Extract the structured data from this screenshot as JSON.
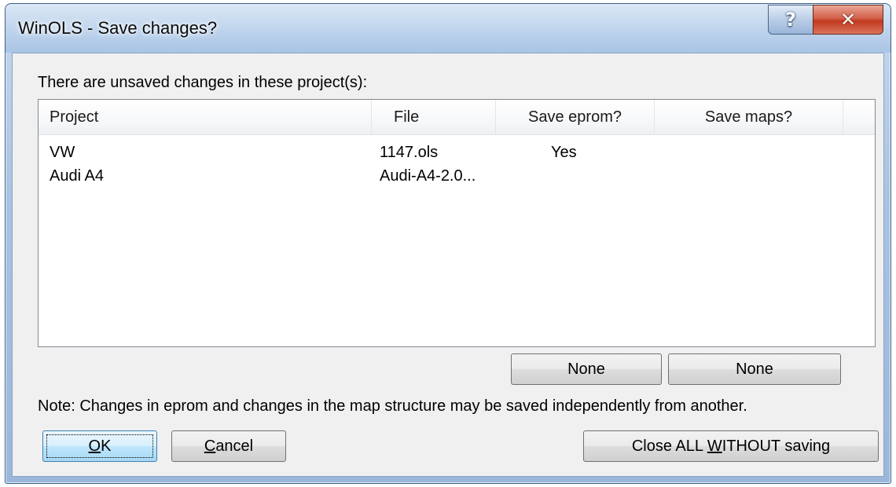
{
  "window": {
    "title": "WinOLS - Save changes?",
    "help_glyph": "?",
    "close_glyph": "✕"
  },
  "intro_text": "There are unsaved changes in these project(s):",
  "table": {
    "columns": [
      "Project",
      "File",
      "Save eprom?",
      "Save maps?"
    ],
    "rows": [
      {
        "project": "VW",
        "file": "1147.ols",
        "save_eprom": "Yes",
        "save_maps": ""
      },
      {
        "project": "Audi A4",
        "file": "Audi-A4-2.0...",
        "save_eprom": "",
        "save_maps": ""
      }
    ]
  },
  "buttons": {
    "eprom_none": "None",
    "maps_none": "None",
    "ok": {
      "accel": "O",
      "rest": "K"
    },
    "cancel": {
      "accel": "C",
      "rest": "ancel"
    },
    "close_all": {
      "before": "Close ALL ",
      "accel": "W",
      "after": "ITHOUT saving"
    }
  },
  "note_text": "Note: Changes in eprom and changes in the map structure may be saved independently from another.",
  "colors": {
    "title_bar": "#c3d7ee",
    "close_button": "#c23a1f",
    "client_bg": "#f0f0f0",
    "default_button_border": "#3c7fb1"
  },
  "icons": {
    "help": "help-icon",
    "close": "close-icon"
  }
}
